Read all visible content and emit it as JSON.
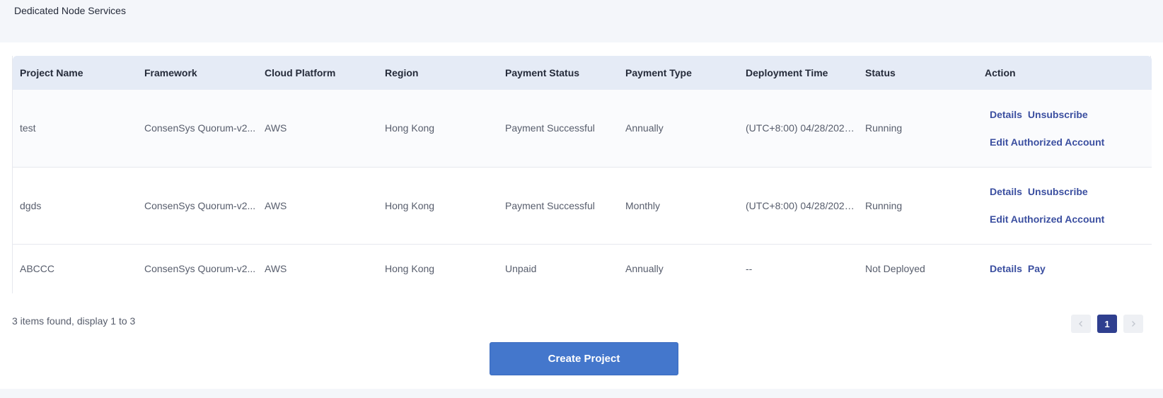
{
  "page": {
    "title": "Dedicated Node Services"
  },
  "table": {
    "headers": [
      "Project Name",
      "Framework",
      "Cloud Platform",
      "Region",
      "Payment Status",
      "Payment Type",
      "Deployment Time",
      "Status",
      "Action"
    ],
    "rows": [
      {
        "project_name": "test",
        "framework": "ConsenSys Quorum-v2...",
        "cloud_platform": "AWS",
        "region": "Hong Kong",
        "payment_status": "Payment Successful",
        "payment_type": "Annually",
        "deployment_time": "(UTC+8:00) 04/28/2021...",
        "status": "Running",
        "actions": {
          "details": "Details",
          "unsubscribe": "Unsubscribe",
          "edit_account": "Edit Authorized Account"
        }
      },
      {
        "project_name": "dgds",
        "framework": "ConsenSys Quorum-v2...",
        "cloud_platform": "AWS",
        "region": "Hong Kong",
        "payment_status": "Payment Successful",
        "payment_type": "Monthly",
        "deployment_time": "(UTC+8:00) 04/28/2021...",
        "status": "Running",
        "actions": {
          "details": "Details",
          "unsubscribe": "Unsubscribe",
          "edit_account": "Edit Authorized Account"
        }
      },
      {
        "project_name": "ABCCC",
        "framework": "ConsenSys Quorum-v2...",
        "cloud_platform": "AWS",
        "region": "Hong Kong",
        "payment_status": "Unpaid",
        "payment_type": "Annually",
        "deployment_time": "--",
        "status": "Not Deployed",
        "actions": {
          "details": "Details",
          "pay": "Pay"
        }
      }
    ]
  },
  "footer": {
    "summary": "3 items found, display 1 to 3",
    "pagination": {
      "prev_icon": "chevron-left-icon",
      "current_page": "1",
      "next_icon": "chevron-right-icon"
    },
    "create_button": "Create Project"
  },
  "colors": {
    "header_bg": "#e5ebf6",
    "link": "#3b4fa0",
    "primary_button": "#4477cc",
    "active_page": "#2f3f8f"
  }
}
